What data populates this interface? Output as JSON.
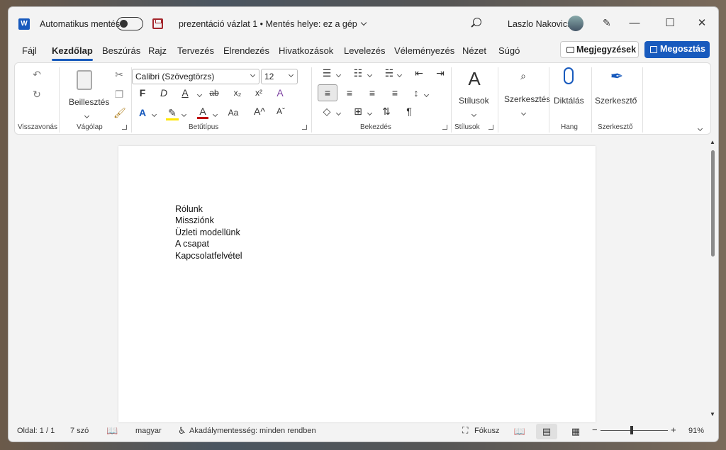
{
  "titlebar": {
    "app_icon": "W",
    "autosave_label": "Automatikus mentés",
    "autosave_state": "off",
    "doc_title": "prezentáció vázlat 1 • Mentés helye: ez a gép",
    "user_name": "Laszlo Nakovics"
  },
  "menu": {
    "items": [
      "Fájl",
      "Kezdőlap",
      "Beszúrás",
      "Rajz",
      "Tervezés",
      "Elrendezés",
      "Hivatkozások",
      "Levelezés",
      "Véleményezés",
      "Nézet",
      "Súgó"
    ],
    "active": "Kezdőlap",
    "comments": "Megjegyzések",
    "share": "Megosztás"
  },
  "ribbon": {
    "undo_group": "Visszavonás",
    "clipboard": {
      "paste": "Beillesztés",
      "group": "Vágólap"
    },
    "font": {
      "name": "Calibri (Szövegtörzs)",
      "size": "12",
      "bold": "F",
      "italic": "D",
      "underline": "A",
      "strike": "ab",
      "subscript": "x₂",
      "superscript": "x²",
      "case": "Aa",
      "grow": "A^",
      "shrink": "Aˇ",
      "group": "Betűtípus"
    },
    "paragraph": {
      "group": "Bekezdés"
    },
    "styles": {
      "label": "Stílusok",
      "group": "Stílusok"
    },
    "editing": {
      "label": "Szerkesztés"
    },
    "voice": {
      "label": "Diktálás",
      "group": "Hang"
    },
    "editor": {
      "label": "Szerkesztő",
      "group": "Szerkesztő"
    }
  },
  "document": {
    "lines": [
      "Rólunk",
      "Missziónk",
      "Üzleti modellünk",
      "A csapat",
      "Kapcsolatfelvétel"
    ]
  },
  "status": {
    "page": "Oldal: 1 / 1",
    "words": "7 szó",
    "language": "magyar",
    "accessibility": "Akadálymentesség: minden rendben",
    "focus": "Fókusz",
    "zoom": "91%"
  },
  "colors": {
    "accent": "#185abd",
    "font_color": "#c00000",
    "highlight": "#ffe600"
  }
}
